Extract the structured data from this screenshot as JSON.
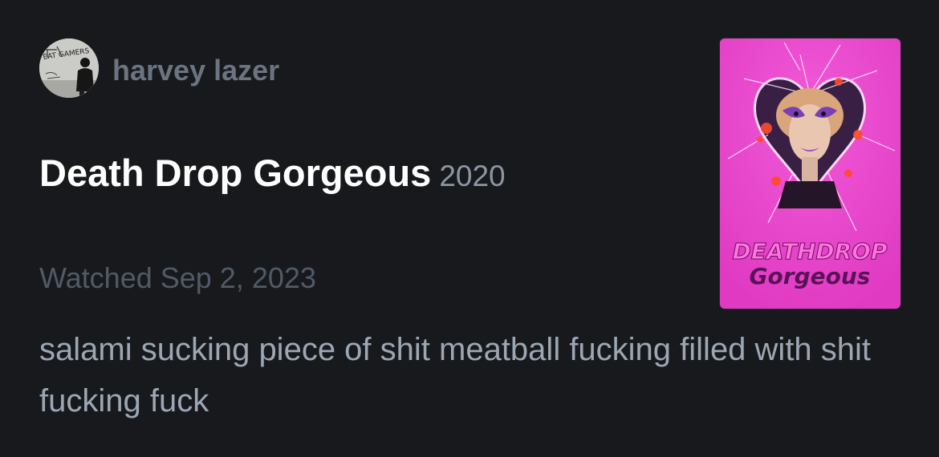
{
  "review": {
    "author": {
      "name": "harvey lazer",
      "avatar_graffiti": "EAT GAMERS"
    },
    "film": {
      "title": "Death Drop Gorgeous",
      "year": "2020",
      "poster": {
        "title_line1": "DEATHDROP",
        "title_line2": "Gorgeous",
        "background_color": "#e93ec8"
      }
    },
    "watched": "Watched Sep 2, 2023",
    "text": "salami sucking piece of shit meatball fucking filled with shit fucking fuck"
  }
}
